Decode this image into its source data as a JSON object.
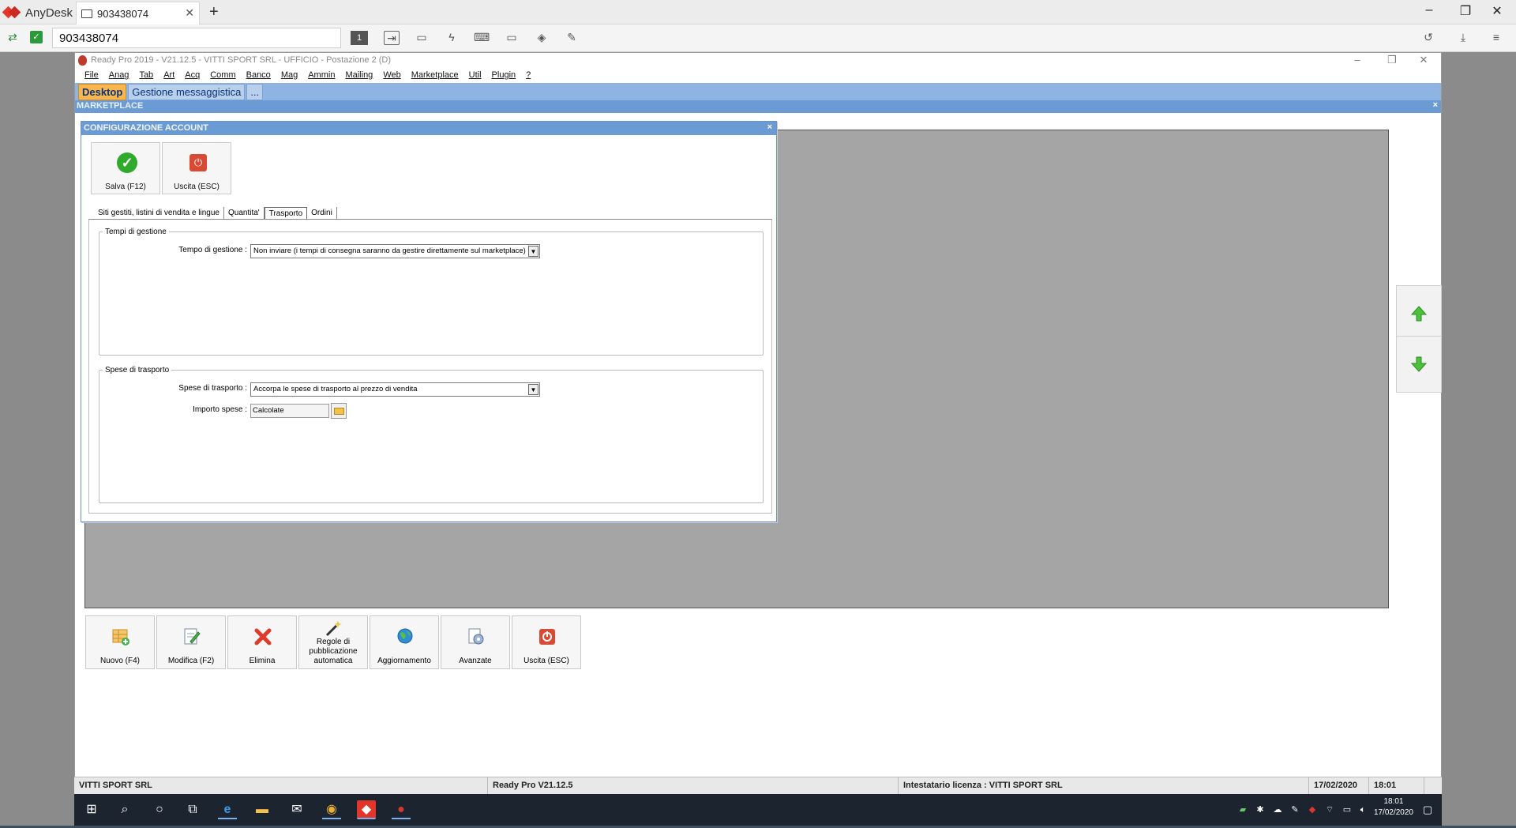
{
  "anydesk": {
    "app_name": "AnyDesk",
    "tab_title": "903438074",
    "new_tab": "+",
    "address": "903438074",
    "minimize": "–",
    "restore": "❐",
    "close": "✕"
  },
  "readypro": {
    "title": "Ready Pro 2019 - V21.12.5 - VITTI SPORT SRL - UFFICIO - Postazione 2 (D)",
    "menu": [
      "File",
      "Anag",
      "Tab",
      "Art",
      "Acq",
      "Comm",
      "Banco",
      "Mag",
      "Ammin",
      "Mailing",
      "Web",
      "Marketplace",
      "Util",
      "Plugin",
      "?"
    ],
    "desk_tabs": [
      "Desktop",
      "Gestione messaggistica",
      "..."
    ],
    "section_title": "MARKETPLACE",
    "close_x": "×"
  },
  "dialog": {
    "title": "CONFIGURAZIONE ACCOUNT",
    "close_x": "×",
    "save_label": "Salva (F12)",
    "exit_label": "Uscita (ESC)",
    "tabs": [
      "Siti gestiti, listini di vendita e lingue",
      "Quantita'",
      "Trasporto",
      "Ordini"
    ],
    "active_tab": "Trasporto",
    "group_tempi": "Tempi di gestione",
    "tempo_label": "Tempo di gestione :",
    "tempo_value": "Non inviare (i tempi di consegna saranno da gestire direttamente sul marketplace)",
    "group_spese": "Spese di trasporto",
    "spese_label": "Spese di trasporto :",
    "spese_value": "Accorpa le spese di trasporto al prezzo di vendita",
    "importo_label": "Importo spese :",
    "importo_value": "Calcolate"
  },
  "actions": [
    {
      "label": "Nuovo (F4)",
      "icon": "new-grid-icon"
    },
    {
      "label": "Modifica (F2)",
      "icon": "edit-icon"
    },
    {
      "label": "Elimina",
      "icon": "delete-icon"
    },
    {
      "label": "Regole di pubblicazione automatica",
      "icon": "magic-wand-icon"
    },
    {
      "label": "Aggiornamento",
      "icon": "globe-icon"
    },
    {
      "label": "Avanzate",
      "icon": "gear-icon"
    },
    {
      "label": "Uscita (ESC)",
      "icon": "exit-icon"
    }
  ],
  "status": {
    "company": "VITTI SPORT SRL",
    "version": "Ready Pro V21.12.5",
    "license": "Intestatario licenza : VITTI SPORT SRL",
    "date": "17/02/2020",
    "time": "18:01"
  },
  "taskbar": {
    "clock_time": "18:01",
    "clock_date": "17/02/2020"
  },
  "colors": {
    "title_blue": "#6b9bd4",
    "desk_tab_active": "#f9b64f",
    "ok_green": "#2faa2c",
    "exit_red": "#d94a35"
  }
}
